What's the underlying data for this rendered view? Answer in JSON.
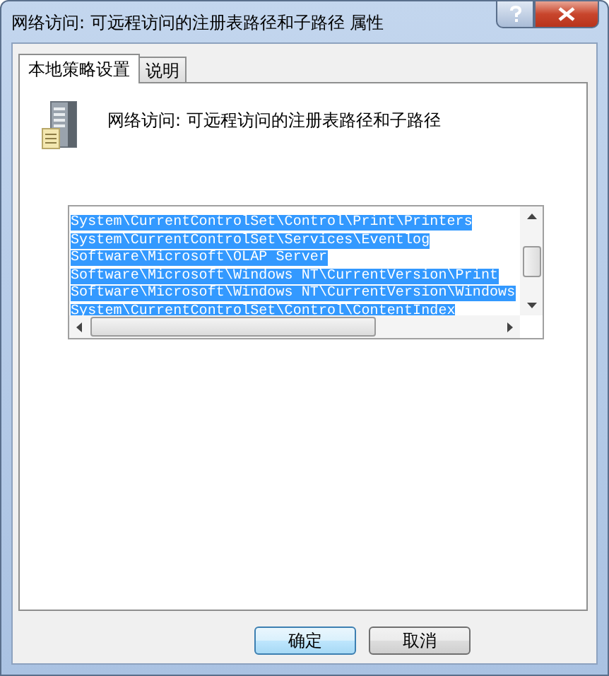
{
  "window": {
    "title": "网络访问: 可远程访问的注册表路径和子路径 属性"
  },
  "tabs": [
    {
      "label": "本地策略设置",
      "selected": true
    },
    {
      "label": "说明",
      "selected": false
    }
  ],
  "policy": {
    "title": "网络访问:  可远程访问的注册表路径和子路径"
  },
  "paths": [
    {
      "text": "System\\CurrentControlSet\\Control\\Print\\Printers",
      "selected": true
    },
    {
      "text": "System\\CurrentControlSet\\Services\\Eventlog",
      "selected": true
    },
    {
      "text": "Software\\Microsoft\\OLAP Server",
      "selected": true
    },
    {
      "text": "Software\\Microsoft\\Windows NT\\CurrentVersion\\Print",
      "selected": true
    },
    {
      "text": "Software\\Microsoft\\Windows NT\\CurrentVersion\\Windows",
      "selected": true
    },
    {
      "text": "System\\CurrentControlSet\\Control\\ContentIndex",
      "selected": true
    }
  ],
  "buttons": [
    {
      "label": "确定",
      "default": true
    },
    {
      "label": "取消",
      "default": false
    }
  ]
}
